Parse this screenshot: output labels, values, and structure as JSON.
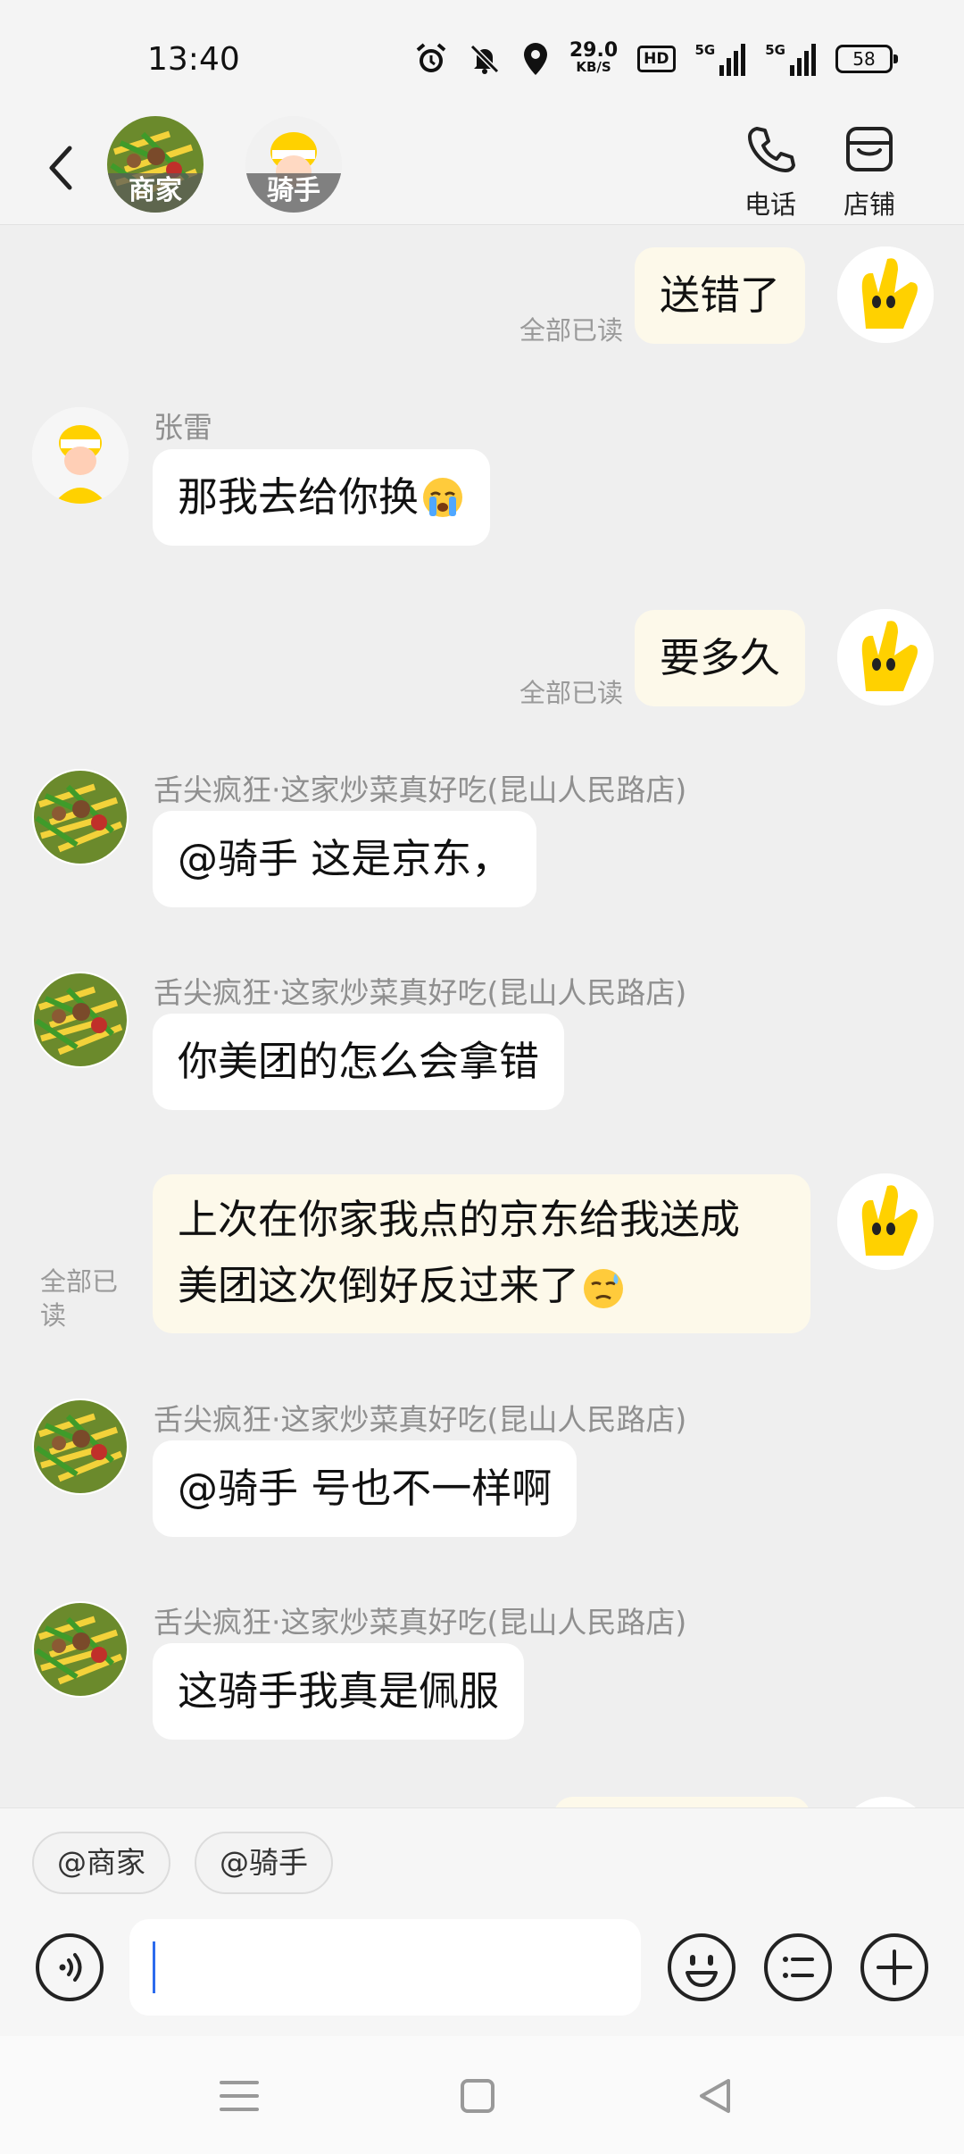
{
  "status": {
    "time": "13:40",
    "net_speed_value": "29.0",
    "net_speed_unit": "KB/S",
    "hd_label": "HD",
    "sim1_label": "5G",
    "sim2_label": "5G",
    "battery": "58",
    "icons": [
      "alarm-icon",
      "mute-icon",
      "location-icon"
    ]
  },
  "header": {
    "merchant_tag": "商家",
    "rider_tag": "骑手",
    "phone_label": "电话",
    "store_label": "店铺"
  },
  "messages": [
    {
      "side": "out",
      "text": "送错了",
      "read": "全部已读"
    },
    {
      "side": "in",
      "sender": "张雷",
      "text": "那我去给你换",
      "emoji": "crying-face"
    },
    {
      "side": "out",
      "text": "要多久",
      "read": "全部已读"
    },
    {
      "side": "in",
      "sender": "舌尖疯狂·这家炒菜真好吃(昆山人民路店)",
      "text": "@骑手 这是京东，"
    },
    {
      "side": "in",
      "sender": "舌尖疯狂·这家炒菜真好吃(昆山人民路店)",
      "text": "你美团的怎么会拿错"
    },
    {
      "side": "out",
      "line1": "上次在你家我点的京东给我送成",
      "line2": "美团这次倒好反过来了",
      "emoji": "worried-face",
      "read": "全部已读"
    },
    {
      "side": "in",
      "sender": "舌尖疯狂·这家炒菜真好吃(昆山人民路店)",
      "text": "@骑手 号也不一样啊"
    },
    {
      "side": "in",
      "sender": "舌尖疯狂·这家炒菜真好吃(昆山人民路店)",
      "text": "这骑手我真是佩服"
    }
  ],
  "input": {
    "chip_merchant": "@商家",
    "chip_rider": "@骑手",
    "value": ""
  },
  "colors": {
    "chat_bg": "#efefef",
    "incoming_bubble": "#ffffff",
    "outgoing_bubble": "#fdf9ea",
    "meituan_yellow": "#ffd100"
  }
}
